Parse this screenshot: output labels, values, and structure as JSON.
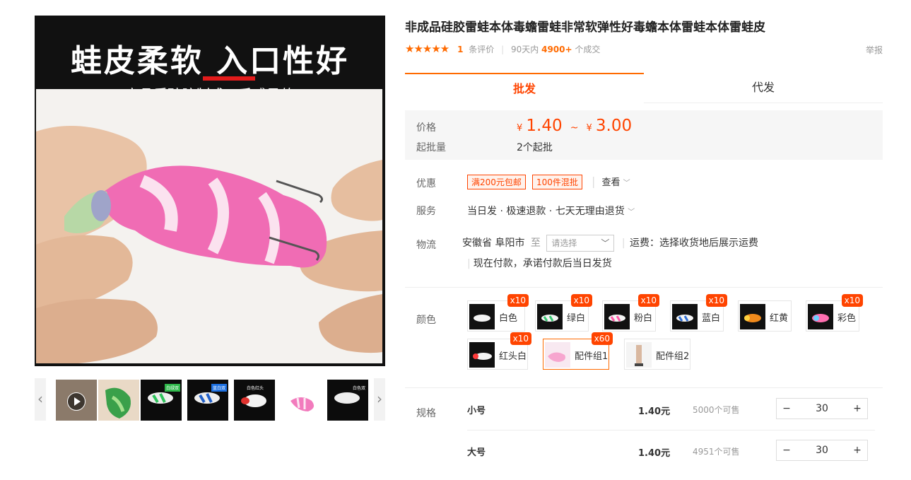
{
  "gallery": {
    "banner_title": "蛙皮柔软  入口性好",
    "banner_sub": "高品质硅胶制成，手感柔软",
    "thumbs": [
      {
        "name": "video-thumb",
        "tag": ""
      },
      {
        "name": "green-frog-thumb",
        "tag": ""
      },
      {
        "name": "green-white-thumb",
        "tag": "白绿双"
      },
      {
        "name": "blue-white-thumb",
        "tag": "蓝白双"
      },
      {
        "name": "red-head-thumb",
        "tag": "白色红头"
      },
      {
        "name": "pink-thumb",
        "tag": ""
      },
      {
        "name": "color-thumb",
        "tag": "白色双"
      }
    ],
    "prev_arrow": "‹",
    "next_arrow": "›"
  },
  "product": {
    "title": "非成品硅胶雷蛙本体毒蟾雷蛙非常软弹性好毒蟾本体雷蛙本体雷蛙皮",
    "stars": "★★★★★",
    "review_count": "1",
    "review_label": "条评价",
    "sold_prefix": "90天内",
    "sold_count": "4900+",
    "sold_suffix": "个成交",
    "report": "举报"
  },
  "tabs": {
    "wholesale": "批发",
    "dropship": "代发"
  },
  "price": {
    "label": "价格",
    "currency": "¥",
    "low": "1.40",
    "sep": "~",
    "high": "3.00",
    "moq_label": "起批量",
    "moq_value": "2个起批"
  },
  "promo": {
    "label": "优惠",
    "coupons": [
      "满200元包邮",
      "100件混批"
    ],
    "view": "查看"
  },
  "service": {
    "label": "服务",
    "text": "当日发 · 极速退款 · 七天无理由退货"
  },
  "logistics": {
    "label": "物流",
    "origin": "安徽省 阜阳市",
    "to": "至",
    "select_placeholder": "请选择",
    "fee": "运费：选择收货地后展示运费",
    "note": "现在付款，承诺付款后当日发货"
  },
  "colors": {
    "label": "颜色",
    "items": [
      {
        "name": "白色",
        "badge": "x10",
        "selected": false,
        "accent": "#ffffff"
      },
      {
        "name": "绿白",
        "badge": "x10",
        "selected": false,
        "accent": "#37c871"
      },
      {
        "name": "粉白",
        "badge": "x10",
        "selected": false,
        "accent": "#ff5aa8"
      },
      {
        "name": "蓝白",
        "badge": "x10",
        "selected": false,
        "accent": "#2f6fd6"
      },
      {
        "name": "红黄",
        "badge": "",
        "selected": false,
        "accent": "#f08a1c"
      },
      {
        "name": "彩色",
        "badge": "x10",
        "selected": false,
        "accent": "#ff6fb0"
      },
      {
        "name": "红头白",
        "badge": "x10",
        "selected": false,
        "accent": "#ff3b3b"
      },
      {
        "name": "配件组1",
        "badge": "x60",
        "selected": true,
        "accent": "#f7c2dc"
      },
      {
        "name": "配件组2",
        "badge": "",
        "selected": false,
        "accent": "#eeeeee"
      }
    ]
  },
  "specs": {
    "label": "规格",
    "rows": [
      {
        "name": "小号",
        "price": "1.40元",
        "stock": "5000个可售",
        "qty": "30"
      },
      {
        "name": "大号",
        "price": "1.40元",
        "stock": "4951个可售",
        "qty": "30"
      }
    ],
    "minus": "−",
    "plus": "+"
  },
  "accent_color": "#ff4400"
}
